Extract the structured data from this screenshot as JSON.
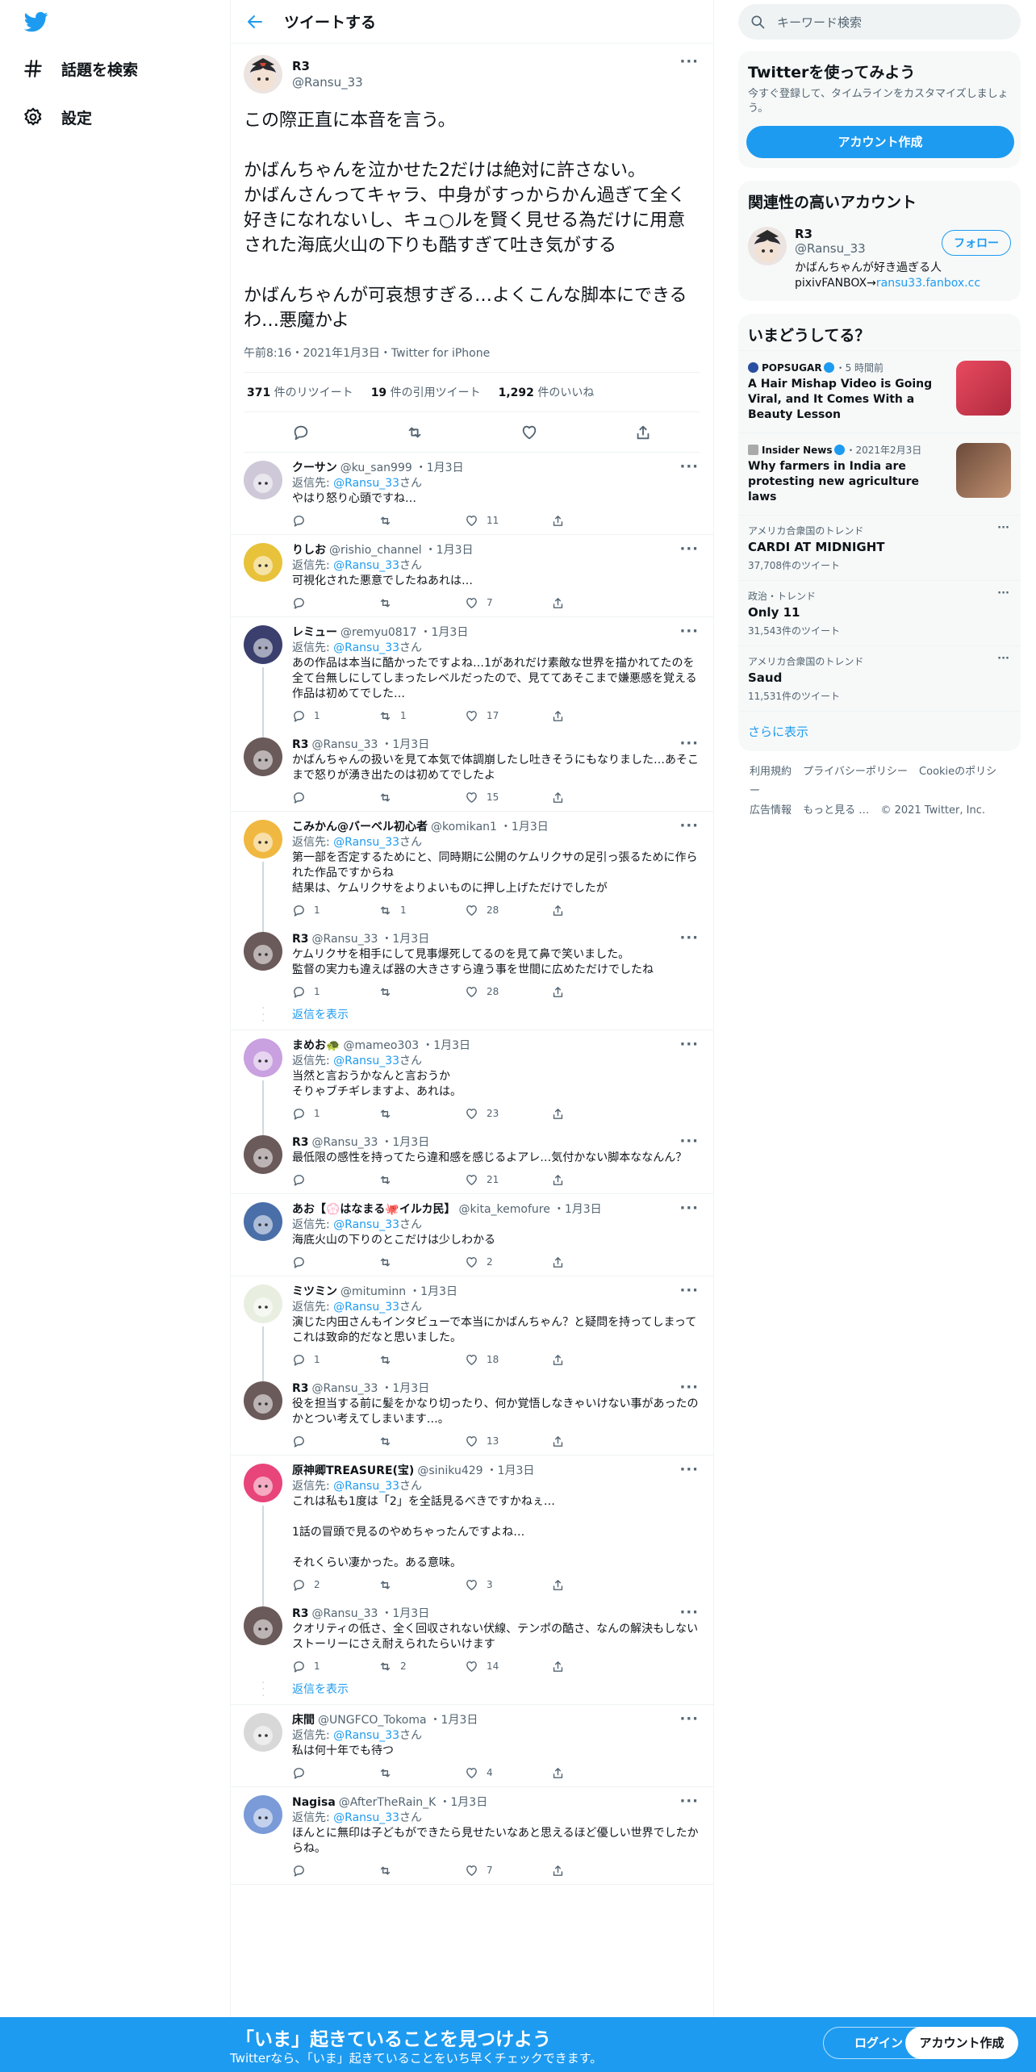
{
  "nav": {
    "explore": "話題を検索",
    "settings": "設定"
  },
  "header": {
    "title": "ツイートする"
  },
  "main_tweet": {
    "name": "R3",
    "handle": "@Ransu_33",
    "body": "この際正直に本音を言う。\n\nかばんちゃんを泣かせた2だけは絶対に許さない。\nかばんさんってキャラ、中身がすっからかん過ぎて全く好きになれないし、キュ○ルを賢く見せる為だけに用意された海底火山の下りも酷すぎて吐き気がする\n\nかばんちゃんが可哀想すぎる…よくこんな脚本にできるわ…悪魔かよ",
    "meta": "午前8:16・2021年1月3日・Twitter for iPhone",
    "retweets_n": "371",
    "retweets_l": " 件のリツイート",
    "quotes_n": "19",
    "quotes_l": " 件の引用ツイート",
    "likes_n": "1,292",
    "likes_l": " 件のいいね"
  },
  "replies": [
    {
      "name": "クーサン",
      "handle": "@ku_san999",
      "date": "1月3日",
      "to": "@Ransu_33",
      "text": "やはり怒り心頭ですね…",
      "reply": "",
      "rt": "",
      "like": "11",
      "thread": false,
      "color": "#cfc8d8"
    },
    {
      "name": "りしお",
      "handle": "@rishio_channel",
      "date": "1月3日",
      "to": "@Ransu_33",
      "text": "可視化された悪意でしたねあれは…",
      "reply": "",
      "rt": "",
      "like": "7",
      "thread": false,
      "color": "#e8c23a"
    },
    {
      "name": "レミュー",
      "handle": "@remyu0817",
      "date": "1月3日",
      "to": "@Ransu_33",
      "text": "あの作品は本当に酷かったですよね…1があれだけ素敵な世界を描かれてたのを全て台無しにしてしまったレベルだったので、見ててあそこまで嫌悪感を覚える作品は初めてでした…",
      "reply": "1",
      "rt": "1",
      "like": "17",
      "thread": true,
      "color": "#3a3f6e"
    },
    {
      "name": "R3",
      "handle": "@Ransu_33",
      "date": "1月3日",
      "to": "",
      "text": "かばんちゃんの扱いを見て本気で体調崩したし吐きそうにもなりました…あそこまで怒りが湧き出たのは初めてでしたよ",
      "reply": "",
      "rt": "",
      "like": "15",
      "thread": false,
      "color": "#6b5a5a"
    },
    {
      "name": "こみかん@バーベル初心者",
      "handle": "@komikan1",
      "date": "1月3日",
      "to": "@Ransu_33",
      "text": "第一部を否定するためにと、同時期に公開のケムリクサの足引っ張るために作られた作品ですからね\n結果は、ケムリクサをよりよいものに押し上げただけでしたが",
      "reply": "1",
      "rt": "1",
      "like": "28",
      "thread": true,
      "color": "#f0b840"
    },
    {
      "name": "R3",
      "handle": "@Ransu_33",
      "date": "1月3日",
      "to": "",
      "text": "ケムリクサを相手にして見事爆死してるのを見て鼻で笑いました。\n監督の実力も違えば器の大きさすら違う事を世間に広めただけでしたね",
      "reply": "1",
      "rt": "",
      "like": "28",
      "thread": false,
      "color": "#6b5a5a",
      "more": "返信を表示"
    },
    {
      "name": "まめお🐢",
      "handle": "@mameo303",
      "date": "1月3日",
      "to": "@Ransu_33",
      "text": "当然と言おうかなんと言おうか\nそりゃブチギレますよ、あれは。",
      "reply": "1",
      "rt": "",
      "like": "23",
      "thread": true,
      "color": "#c9a0e0"
    },
    {
      "name": "R3",
      "handle": "@Ransu_33",
      "date": "1月3日",
      "to": "",
      "text": "最低限の感性を持ってたら違和感を感じるよアレ…気付かない脚本ななんん？",
      "reply": "",
      "rt": "",
      "like": "21",
      "thread": false,
      "color": "#6b5a5a"
    },
    {
      "name": "あお【💮はなまる🐙イルカ民】",
      "handle": "@kita_kemofure",
      "date": "1月3日",
      "to": "@Ransu_33",
      "text": "海底火山の下りのとこだけは少しわかる",
      "reply": "",
      "rt": "",
      "like": "2",
      "thread": false,
      "color": "#4a6ea8"
    },
    {
      "name": "ミツミン",
      "handle": "@mituminn",
      "date": "1月3日",
      "to": "@Ransu_33",
      "text": "演じた内田さんもインタビューで本当にかばんちゃん？と疑問を持ってしまってこれは致命的だなと思いました。",
      "reply": "1",
      "rt": "",
      "like": "18",
      "thread": true,
      "color": "#e8efe0"
    },
    {
      "name": "R3",
      "handle": "@Ransu_33",
      "date": "1月3日",
      "to": "",
      "text": "役を担当する前に髪をかなり切ったり、何か覚悟しなきゃいけない事があったのかとつい考えてしまいます…。",
      "reply": "",
      "rt": "",
      "like": "13",
      "thread": false,
      "color": "#6b5a5a"
    },
    {
      "name": "原神卿TREASURE(宝)",
      "handle": "@siniku429",
      "date": "1月3日",
      "to": "@Ransu_33",
      "text": "これは私も1度は「2」を全話見るべきですかねぇ…\n\n1話の冒頭で見るのやめちゃったんですよね…\n\nそれくらい凄かった。ある意味。",
      "reply": "2",
      "rt": "",
      "like": "3",
      "thread": true,
      "color": "#e8457a"
    },
    {
      "name": "R3",
      "handle": "@Ransu_33",
      "date": "1月3日",
      "to": "",
      "text": "クオリティの低さ、全く回収されない伏線、テンポの酷さ、なんの解決もしないストーリーにさえ耐えられたらいけます",
      "reply": "1",
      "rt": "2",
      "like": "14",
      "thread": false,
      "color": "#6b5a5a",
      "more": "返信を表示"
    },
    {
      "name": "床間",
      "handle": "@UNGFCO_Tokoma",
      "date": "1月3日",
      "to": "@Ransu_33",
      "text": "私は何十年でも待つ",
      "reply": "",
      "rt": "",
      "like": "4",
      "thread": false,
      "color": "#d8d8d8"
    },
    {
      "name": "Nagisa",
      "handle": "@AfterTheRain_K",
      "date": "1月3日",
      "to": "@Ransu_33",
      "text": "ほんとに無印は子どもができたら見せたいなあと思えるほど優しい世界でしたからね。",
      "reply": "",
      "rt": "",
      "like": "7",
      "thread": false,
      "color": "#7a9ad8"
    }
  ],
  "reply_prefix": "返信先: ",
  "reply_suffix": "さん",
  "sidebar": {
    "search_placeholder": "キーワード検索",
    "try": {
      "title": "Twitterを使ってみよう",
      "sub": "今すぐ登録して、タイムラインをカスタマイズしましょう。",
      "button": "アカウント作成"
    },
    "related": {
      "title": "関連性の高いアカウント",
      "name": "R3",
      "handle": "@Ransu_33",
      "follow": "フォロー",
      "bio_line1": "かばんちゃんが好き過ぎる人",
      "bio_line2": "pixivFANBOX→",
      "bio_link": "ransu33.fanbox.cc"
    },
    "happening": {
      "title": "いまどうしてる？",
      "stories": [
        {
          "src": "POPSUGAR",
          "time": "・5 時間前",
          "title": "A Hair Mishap Video is Going Viral, and It Comes With a Beauty Lesson"
        },
        {
          "src": "Insider News",
          "time": "・2021年2月3日",
          "title": "Why farmers in India are protesting new agriculture laws"
        }
      ],
      "trends": [
        {
          "ctx": "アメリカ合衆国のトレンド",
          "name": "CARDI AT MIDNIGHT",
          "count": "37,708件のツイート"
        },
        {
          "ctx": "政治・トレンド",
          "name": "Only 11",
          "count": "31,543件のツイート"
        },
        {
          "ctx": "アメリカ合衆国のトレンド",
          "name": "Saud",
          "count": "11,531件のツイート"
        }
      ],
      "more": "さらに表示"
    },
    "footer": [
      "利用規約",
      "プライバシーポリシー",
      "Cookieのポリシー",
      "広告情報",
      "もっと見る …",
      "© 2021 Twitter, Inc."
    ]
  },
  "bottom": {
    "title": "「いま」起きていることを見つけよう",
    "sub": "Twitterなら、「いま」起きていることをいち早くチェックできます。",
    "login": "ログイン",
    "signup": "アカウント作成"
  },
  "colors": {
    "accent": "#1d9bf0"
  }
}
